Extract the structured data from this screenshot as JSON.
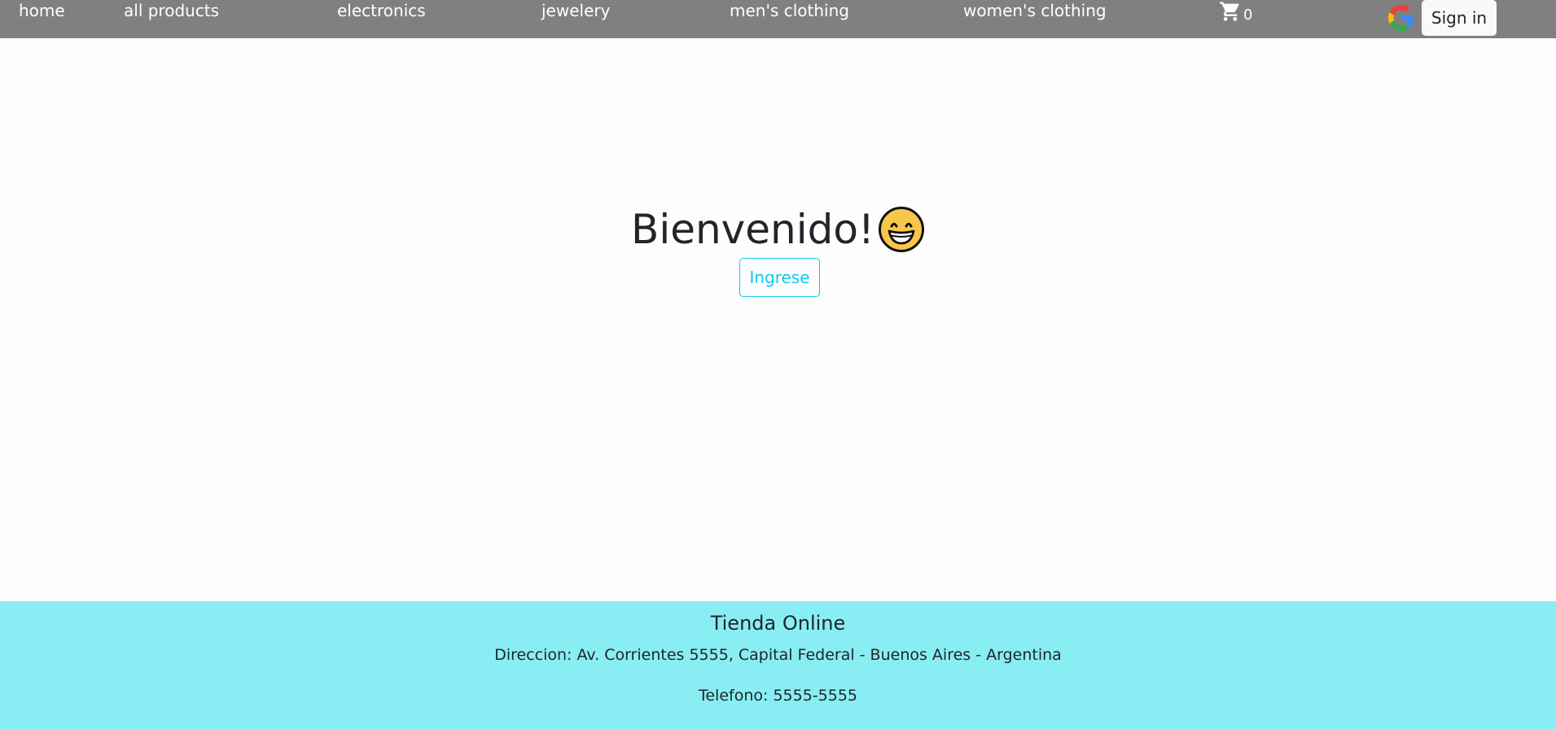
{
  "nav": {
    "links": [
      {
        "label": "home"
      },
      {
        "label": "all products"
      },
      {
        "label": "electronics"
      },
      {
        "label": "jewelery"
      },
      {
        "label": "men's clothing"
      },
      {
        "label": "women's clothing"
      }
    ],
    "cart_icon": "shopping-cart-icon",
    "cart_count": "0",
    "google_icon": "google-logo-icon",
    "signin_label": "Sign in"
  },
  "main": {
    "welcome": "Bienvenido!",
    "welcome_emoji": "grinning-face-icon",
    "ingrese_label": "Ingrese"
  },
  "footer": {
    "title": "Tienda Online",
    "address": "Direccion: Av. Corrientes 5555, Capital Federal - Buenos Aires - Argentina",
    "phone": "Telefono: 5555-5555"
  },
  "colors": {
    "navbar_bg": "#808080",
    "footer_bg": "#88eef3",
    "accent": "#0dcaf0",
    "page_bg": "#fdfdfd"
  }
}
